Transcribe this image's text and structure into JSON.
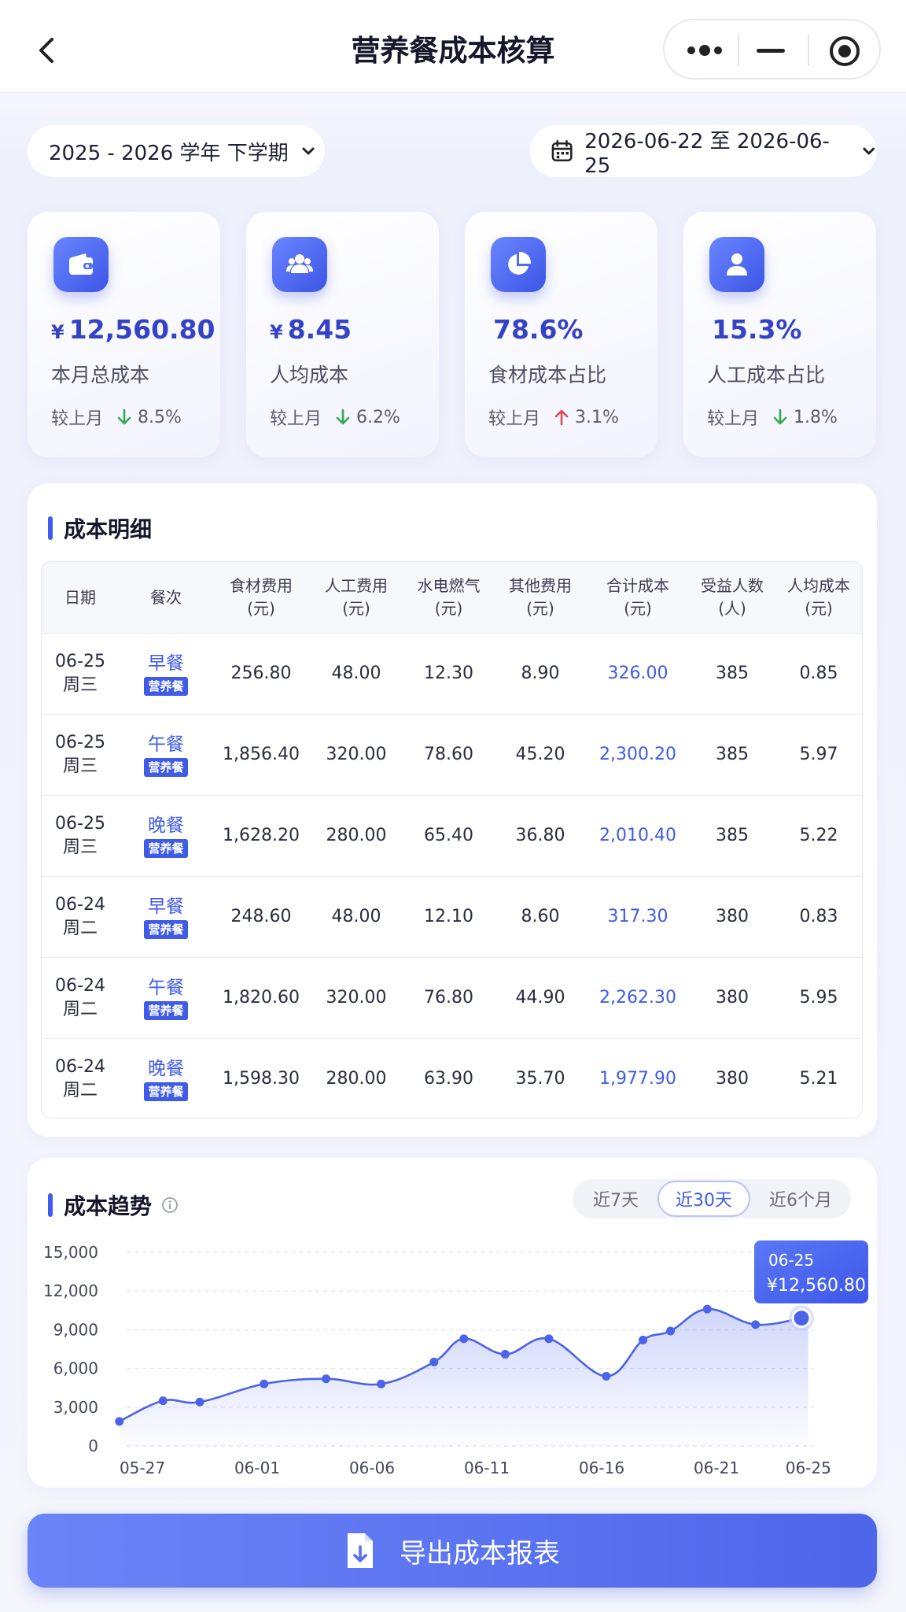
{
  "nav": {
    "title": "营养餐成本核算"
  },
  "filters": {
    "term": "2025 - 2026 学年 下学期",
    "date_range": "2026-06-22 至 2026-06-25"
  },
  "cards": [
    {
      "currency": "¥",
      "value": "12,560.80",
      "label": "本月总成本",
      "compare_label": "较上月",
      "direction": "down",
      "change": "8.5%",
      "icon": "wallet-icon"
    },
    {
      "currency": "¥",
      "value": "8.45",
      "label": "人均成本",
      "compare_label": "较上月",
      "direction": "down",
      "change": "6.2%",
      "icon": "users-icon"
    },
    {
      "currency": "",
      "value": "78.6%",
      "label": "食材成本占比",
      "compare_label": "较上月",
      "direction": "up",
      "change": "3.1%",
      "icon": "pie-chart-icon"
    },
    {
      "currency": "",
      "value": "15.3%",
      "label": "人工成本占比",
      "compare_label": "较上月",
      "direction": "down",
      "change": "1.8%",
      "icon": "user-icon"
    }
  ],
  "colors": {
    "accent": "#3f5be8",
    "down": "#34a853",
    "up": "#e5484d"
  },
  "detail": {
    "title": "成本明细",
    "headers": [
      {
        "l1": "日期",
        "l2": ""
      },
      {
        "l1": "餐次",
        "l2": ""
      },
      {
        "l1": "食材费用",
        "l2": "(元)"
      },
      {
        "l1": "人工费用",
        "l2": "(元)"
      },
      {
        "l1": "水电燃气",
        "l2": "(元)"
      },
      {
        "l1": "其他费用",
        "l2": "(元)"
      },
      {
        "l1": "合计成本",
        "l2": "(元)"
      },
      {
        "l1": "受益人数",
        "l2": "(人)"
      },
      {
        "l1": "人均成本",
        "l2": "(元)"
      }
    ],
    "rows": [
      {
        "date": "06-25",
        "weekday": "周三",
        "meal": "早餐",
        "tag": "营养餐",
        "food": "256.80",
        "labor": "48.00",
        "utility": "12.30",
        "other": "8.90",
        "total": "326.00",
        "people": "385",
        "avg": "0.85"
      },
      {
        "date": "06-25",
        "weekday": "周三",
        "meal": "午餐",
        "tag": "营养餐",
        "food": "1,856.40",
        "labor": "320.00",
        "utility": "78.60",
        "other": "45.20",
        "total": "2,300.20",
        "people": "385",
        "avg": "5.97"
      },
      {
        "date": "06-25",
        "weekday": "周三",
        "meal": "晚餐",
        "tag": "营养餐",
        "food": "1,628.20",
        "labor": "280.00",
        "utility": "65.40",
        "other": "36.80",
        "total": "2,010.40",
        "people": "385",
        "avg": "5.22"
      },
      {
        "date": "06-24",
        "weekday": "周二",
        "meal": "早餐",
        "tag": "营养餐",
        "food": "248.60",
        "labor": "48.00",
        "utility": "12.10",
        "other": "8.60",
        "total": "317.30",
        "people": "380",
        "avg": "0.83"
      },
      {
        "date": "06-24",
        "weekday": "周二",
        "meal": "午餐",
        "tag": "营养餐",
        "food": "1,820.60",
        "labor": "320.00",
        "utility": "76.80",
        "other": "44.90",
        "total": "2,262.30",
        "people": "380",
        "avg": "5.95"
      },
      {
        "date": "06-24",
        "weekday": "周二",
        "meal": "晚餐",
        "tag": "营养餐",
        "food": "1,598.30",
        "labor": "280.00",
        "utility": "63.90",
        "other": "35.70",
        "total": "1,977.90",
        "people": "380",
        "avg": "5.21"
      }
    ]
  },
  "trend": {
    "title": "成本趋势",
    "ranges": [
      "近7天",
      "近30天",
      "近6个月"
    ],
    "active_range": "近30天",
    "tooltip": {
      "date": "06-25",
      "value": "¥12,560.80"
    }
  },
  "chart_data": {
    "type": "area",
    "ylim": [
      0,
      15000
    ],
    "y_ticks": [
      "15,000",
      "12,000",
      "9,000",
      "6,000",
      "3,000",
      "0"
    ],
    "x_tick_labels": [
      "05-27",
      "06-01",
      "06-06",
      "06-11",
      "06-16",
      "06-21",
      "06-25"
    ],
    "x_day_offsets": [
      0,
      5,
      10,
      15,
      20,
      25,
      29
    ],
    "points": [
      {
        "day": -1,
        "y": 1900
      },
      {
        "day": 0.9,
        "y": 3500
      },
      {
        "day": 2.5,
        "y": 3400
      },
      {
        "day": 5.3,
        "y": 4800
      },
      {
        "day": 8.0,
        "y": 5200
      },
      {
        "day": 10.4,
        "y": 4800
      },
      {
        "day": 12.7,
        "y": 6500
      },
      {
        "day": 14.0,
        "y": 8300
      },
      {
        "day": 15.8,
        "y": 7100
      },
      {
        "day": 17.7,
        "y": 8300
      },
      {
        "day": 20.2,
        "y": 5400
      },
      {
        "day": 21.8,
        "y": 8200
      },
      {
        "day": 23.0,
        "y": 8900
      },
      {
        "day": 24.6,
        "y": 10600
      },
      {
        "day": 26.7,
        "y": 9400
      },
      {
        "day": 28.7,
        "y": 9900
      }
    ],
    "grid": true,
    "grid_style": "dashed"
  },
  "export": {
    "label": "导出成本报表"
  }
}
